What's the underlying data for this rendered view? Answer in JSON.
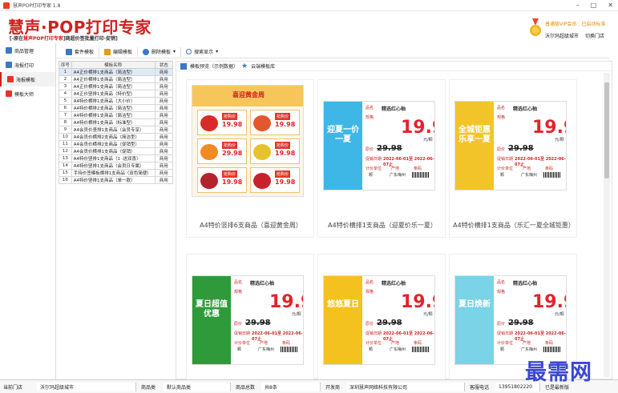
{
  "window": {
    "title": "慧声POP打印专家 1.8"
  },
  "header": {
    "logo": "慧声·POP打印专家",
    "slogan_prefix": "[·原在",
    "slogan_brand": "慧声POP打印专家",
    "slogan_suffix": "]商超价签批量打印·促销]",
    "vip": "普通版VIP会员：已启动标准",
    "store_link": "沃尔玛超级城市",
    "switch_store": "切换门店"
  },
  "sidebar": {
    "items": [
      {
        "label": "商品管理",
        "color": "#3a78c9"
      },
      {
        "label": "海报打印",
        "color": "#3a78c9"
      },
      {
        "label": "海报模板",
        "color": "#e4352b"
      },
      {
        "label": "模板大师",
        "color": "#e4352b"
      }
    ]
  },
  "toolbar": {
    "buttons": [
      {
        "label": "套件模板",
        "color": "#3a78c9"
      },
      {
        "label": "编辑模板",
        "color": "#e59a1a"
      },
      {
        "label": "删除模板",
        "color": "#3a78c9"
      },
      {
        "label": "搜索显示",
        "color": "#3a78c9"
      }
    ]
  },
  "table": {
    "headers": [
      "序号",
      "模板名称",
      "状态"
    ],
    "rows": [
      [
        "1",
        "A4正价横排1支商品（简洁型）",
        "商用"
      ],
      [
        "2",
        "A4正价横排1支商品（简洁型）",
        "商用"
      ],
      [
        "3",
        "A4正价横排1支商品（简洁型）",
        "商用"
      ],
      [
        "4",
        "A4正价竖排1支商品（特价型）",
        "商用"
      ],
      [
        "5",
        "A4特价横排1支商品（大小价）",
        "商用"
      ],
      [
        "6",
        "A4特价横排2支商品（简洁型）",
        "商用"
      ],
      [
        "7",
        "A4特价横排1支商品（简洁型）",
        "商用"
      ],
      [
        "8",
        "A4特价横排1支商品（标准型）",
        "商用"
      ],
      [
        "9",
        "A4会员价竖排1支商品（会员专享）",
        "商用"
      ],
      [
        "10",
        "A4会员价横排2支商品（简洁型）",
        "商用"
      ],
      [
        "11",
        "A4会员价横排2支商品（促销型）",
        "商用"
      ],
      [
        "12",
        "A4会员价横排1支商品（促销）",
        "商用"
      ],
      [
        "13",
        "A4特价竖排1支商品（1 ·送双喜）",
        "商用"
      ],
      [
        "14",
        "A4特价竖排1支商品（会员日专属）",
        "商用"
      ],
      [
        "15",
        "手持价签模板横排1支商品（双色简便）",
        "商用"
      ],
      [
        "16",
        "A4特价竖排1支商品（单一款）",
        "商用"
      ]
    ]
  },
  "panel": {
    "tab1": "模板预览（示例数据）",
    "tab2": "云端模板库"
  },
  "cards": [
    {
      "label": "A4特价竖排6支商品（喜迎黄金周）",
      "theme": "喜迎黄金周"
    },
    {
      "label": "A4特价横排1支商品（迎夏价乐一夏）",
      "theme": "迎夏一价一夏"
    },
    {
      "label": "A4特价横排1支商品（乐汇一夏全城钜惠）",
      "theme": "全城钜惠乐享一夏"
    },
    {
      "label": "",
      "theme": "夏日超值优惠"
    },
    {
      "label": "",
      "theme": "悠悠夏日"
    },
    {
      "label": "",
      "theme": "夏日焕新"
    }
  ],
  "poster_text": {
    "product": "精选红心柚",
    "price": "19.98",
    "unit": "元/颗",
    "old_price": "29.98",
    "date_range": "2022-06-01至 2022-06-07止",
    "fields": [
      "计价单位",
      "产地",
      "条码"
    ],
    "field_vals": [
      "颗",
      "广东梅州",
      ""
    ],
    "grade_label": "规格",
    "date_label": "促销日期",
    "origin_label": "原价",
    "header_label": "品名",
    "promo": "抢购价",
    "small_price": "19.98",
    "grid_prices": [
      "19.98",
      "19.98",
      "29.98",
      "19.98",
      "19.98",
      "19.98"
    ]
  },
  "status": {
    "store_label": "当前门店",
    "store_value": "沃尔玛超级城市",
    "category_label": "商品类",
    "category_value": "默认商品类",
    "count_label": "商品总数",
    "count_value": "共8条",
    "dev_label": "开发商",
    "dev_value": "深圳慧声网络科技有限公司",
    "phone_label": "客服电话",
    "phone_value": "13951802220",
    "version": "已是最新版"
  },
  "watermark": "最需网",
  "colors": {
    "brand": "#d21f1f",
    "accent": "#e4352b",
    "selected": "#dfeaf7"
  }
}
